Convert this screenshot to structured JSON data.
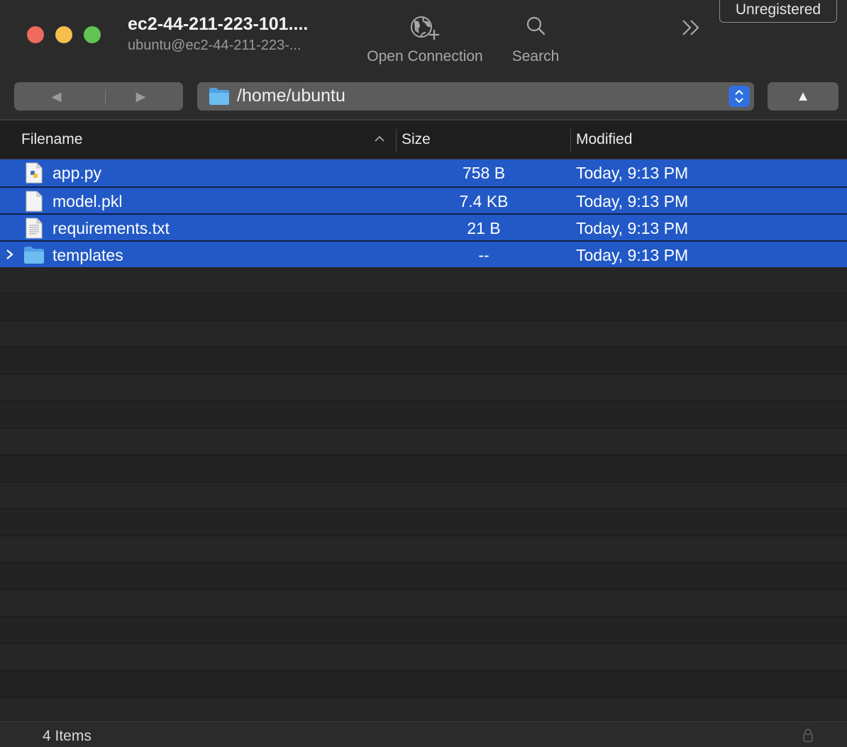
{
  "window": {
    "title": "ec2-44-211-223-101....",
    "subtitle": "ubuntu@ec2-44-211-223-..."
  },
  "toolbar": {
    "open_connection_label": "Open Connection",
    "search_label": "Search",
    "unregistered_label": "Unregistered"
  },
  "navigation": {
    "back_glyph": "◀",
    "forward_glyph": "▶",
    "up_glyph": "▲",
    "path": "/home/ubuntu"
  },
  "columns": {
    "filename": "Filename",
    "size": "Size",
    "modified": "Modified",
    "sort": "ascending"
  },
  "files": [
    {
      "name": "app.py",
      "size": "758 B",
      "modified": "Today, 9:13 PM",
      "icon": "python-file-icon",
      "selected": true
    },
    {
      "name": "model.pkl",
      "size": "7.4 KB",
      "modified": "Today, 9:13 PM",
      "icon": "blank-file-icon",
      "selected": true
    },
    {
      "name": "requirements.txt",
      "size": "21 B",
      "modified": "Today, 9:13 PM",
      "icon": "text-file-icon",
      "selected": true
    },
    {
      "name": "templates",
      "size": "--",
      "modified": "Today, 9:13 PM",
      "icon": "folder-icon",
      "selected": true,
      "expandable": true
    }
  ],
  "status": {
    "item_count": "4 Items"
  },
  "colors": {
    "selection": "#2259c6",
    "accent": "#2f6fe0",
    "background": "#1e1e1e"
  }
}
